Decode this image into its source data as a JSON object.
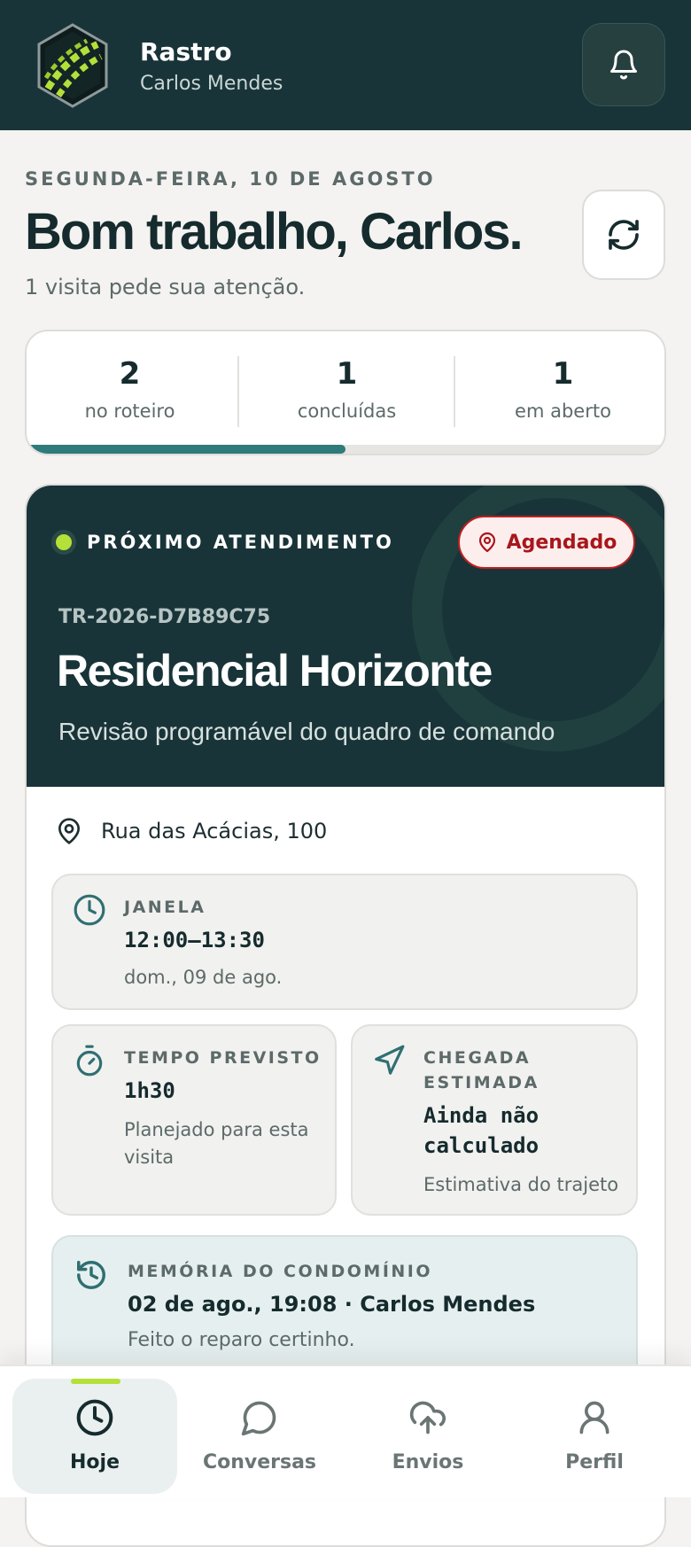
{
  "header": {
    "app_name": "Rastro",
    "user_name": "Carlos Mendes"
  },
  "greeting": {
    "date": "SEGUNDA-FEIRA, 10 DE AGOSTO",
    "title": "Bom trabalho, Carlos.",
    "subtitle": "1 visita pede sua atenção."
  },
  "stats": [
    {
      "value": "2",
      "label": "no roteiro"
    },
    {
      "value": "1",
      "label": "concluídas"
    },
    {
      "value": "1",
      "label": "em aberto"
    }
  ],
  "progress": {
    "completed_fraction": 0.5
  },
  "visit": {
    "next_label": "PRÓXIMO ATENDIMENTO",
    "status": "Agendado",
    "code": "TR-2026-D7B89C75",
    "title": "Residencial Horizonte",
    "description": "Revisão programável do quadro de comando",
    "address": "Rua das Acácias, 100",
    "window": {
      "label": "JANELA",
      "value": "12:00–13:30",
      "sub": "dom., 09 de ago."
    },
    "duration": {
      "label": "TEMPO PREVISTO",
      "value": "1h30",
      "sub": "Planejado para esta visita"
    },
    "arrival": {
      "label": "CHEGADA ESTIMADA",
      "value": "Ainda não calculado",
      "sub": "Estimativa do trajeto"
    },
    "memory": {
      "label": "MEMÓRIA DO CONDOMÍNIO",
      "value": "02 de ago., 19:08 · Carlos Mendes",
      "sub": "Feito o reparo certinho."
    }
  },
  "nav": [
    {
      "label": "Hoje",
      "icon": "clock-icon",
      "active": true
    },
    {
      "label": "Conversas",
      "icon": "chat-icon",
      "active": false
    },
    {
      "label": "Envios",
      "icon": "cloud-upload-icon",
      "active": false
    },
    {
      "label": "Perfil",
      "icon": "user-icon",
      "active": false
    }
  ],
  "colors": {
    "header_bg": "#183438",
    "accent_lime": "#b4e03a",
    "teal": "#2f7a7a",
    "status_red": "#c01f1f"
  }
}
